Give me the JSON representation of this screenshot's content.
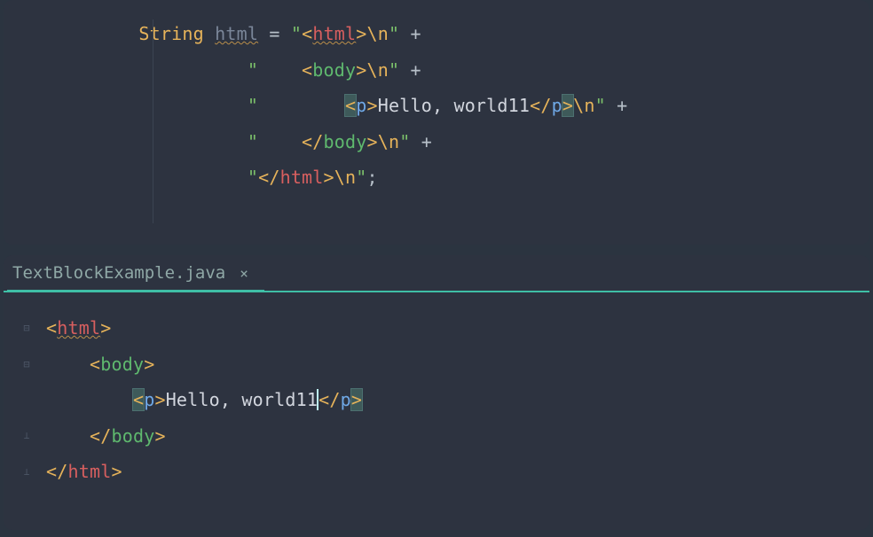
{
  "top": {
    "keyword": "String",
    "variable": "html",
    "assign": " = ",
    "plus": " +",
    "semicolon": ";",
    "newline_escape": "\\n",
    "quote": "\"",
    "indent2": "    ",
    "indent4": "        ",
    "lt": "<",
    "gt": ">",
    "slash": "/",
    "tag_html": "html",
    "tag_body": "body",
    "tag_p": "p",
    "text_hello": "Hello, world11"
  },
  "tab": {
    "filename": "TextBlockExample.java",
    "close": "×"
  },
  "bottom": {
    "lt": "<",
    "gt": ">",
    "slash": "/",
    "tag_html": "html",
    "tag_body": "body",
    "tag_p": "p",
    "text_hello": "Hello, world11",
    "indent2": "    ",
    "indent4": "        "
  }
}
